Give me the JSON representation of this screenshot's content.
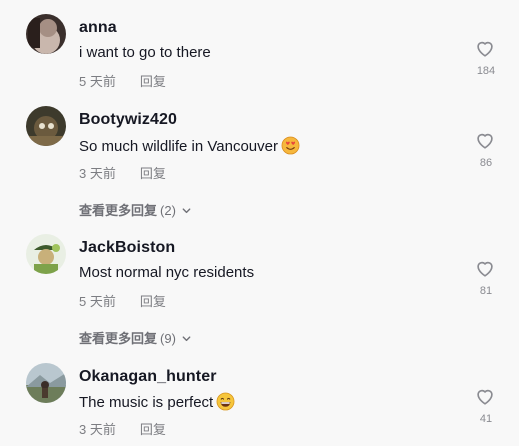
{
  "comments": [
    {
      "username": "anna",
      "text": "i want to go to there",
      "time": "5 天前",
      "reply_label": "回复",
      "likes": "184",
      "avatar_icon": "avatar-photo"
    },
    {
      "username": "Bootywiz420",
      "text": "So much wildlife in Vancouver",
      "emoji": "heart-eyes-emoji",
      "time": "3 天前",
      "reply_label": "回复",
      "likes": "86",
      "more_replies_label": "查看更多回复",
      "more_replies_count": "(2)",
      "avatar_icon": "avatar-photo"
    },
    {
      "username": "JackBoiston",
      "text": "Most normal nyc residents",
      "time": "5 天前",
      "reply_label": "回复",
      "likes": "81",
      "more_replies_label": "查看更多回复",
      "more_replies_count": "(9)",
      "avatar_icon": "avatar-photo"
    },
    {
      "username": "Okanagan_hunter",
      "text": "The music is perfect",
      "emoji": "grinning-emoji",
      "time": "3 天前",
      "reply_label": "回复",
      "likes": "41",
      "avatar_icon": "avatar-photo"
    }
  ],
  "icons": {
    "like": "heart-outline-icon",
    "expand": "chevron-down-icon"
  },
  "colors": {
    "background": "#f8f8f8",
    "text": "#161823",
    "muted": "#7c7d82"
  }
}
